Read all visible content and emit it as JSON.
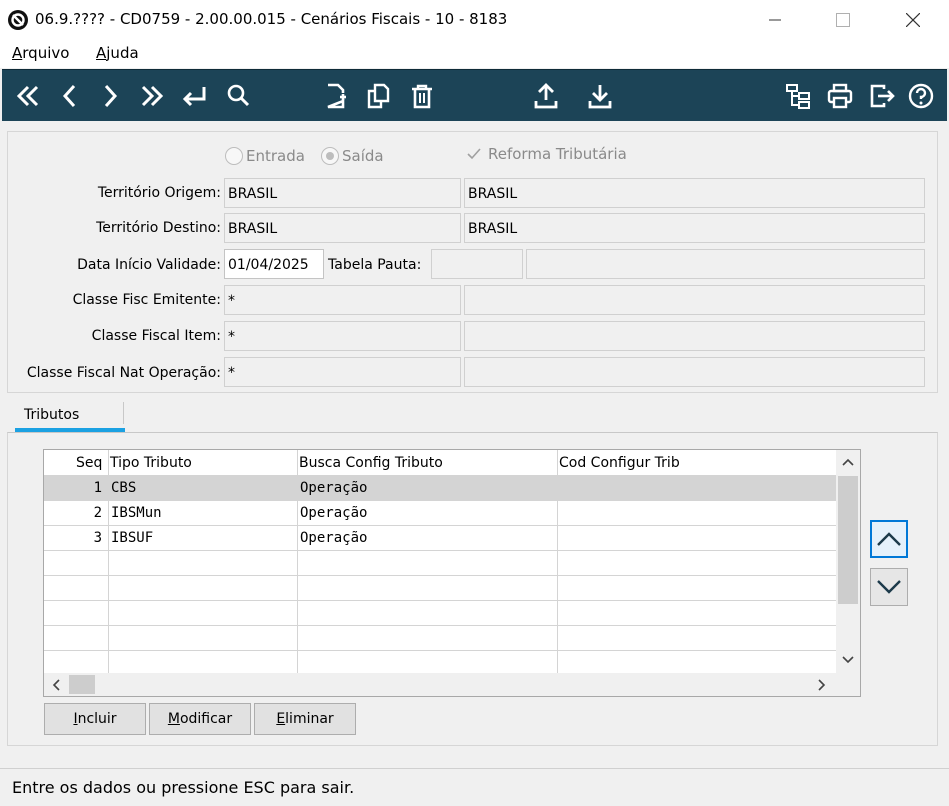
{
  "window": {
    "title": "06.9.???? - CD0759 - 2.00.00.015 - Cenários Fiscais - 10 - 8183",
    "minimize_glyph": "—",
    "maximize_glyph": "☐",
    "close_glyph": "✕"
  },
  "menu": {
    "arquivo": {
      "first": "A",
      "rest": "rquivo"
    },
    "ajuda": {
      "first": "A",
      "rest": "juda"
    }
  },
  "toolbar": {
    "icons": [
      "first-record-icon",
      "previous-record-icon",
      "next-record-icon",
      "last-record-icon",
      "go-to-icon",
      "search-icon",
      "new-document-icon",
      "copy-icon",
      "delete-icon",
      "export-icon",
      "import-icon",
      "structure-icon",
      "print-icon",
      "exit-icon",
      "help-icon"
    ],
    "background": "#1c4457"
  },
  "form": {
    "radio_entrada": "Entrada",
    "radio_saida": "Saída",
    "reforma_label": "Reforma Tributária",
    "territorio_origem_label": "Território Origem:",
    "territorio_origem_code": "BRASIL",
    "territorio_origem_desc": "BRASIL",
    "territorio_destino_label": "Território Destino:",
    "territorio_destino_code": "BRASIL",
    "territorio_destino_desc": "BRASIL",
    "data_inicio_label": "Data Início Validade:",
    "data_inicio_value": "01/04/2025",
    "tabela_pauta_label": "Tabela Pauta:",
    "tabela_pauta_code": "",
    "tabela_pauta_desc": "",
    "classe_emitente_label": "Classe Fisc Emitente:",
    "classe_emitente_value": "*",
    "classe_emitente_desc": "",
    "classe_item_label": "Classe Fiscal Item:",
    "classe_item_value": "*",
    "classe_item_desc": "",
    "classe_natop_label": "Classe Fiscal Nat Operação:",
    "classe_natop_value": "*",
    "classe_natop_desc": ""
  },
  "tabs": {
    "tributos": "Tributos"
  },
  "grid": {
    "columns": [
      "Seq",
      "Tipo Tributo",
      "Busca Config Tributo",
      "Cod Configur Trib"
    ],
    "rows": [
      {
        "seq": "1",
        "tipo": "CBS",
        "busca": "Operação",
        "cod": ""
      },
      {
        "seq": "2",
        "tipo": "IBSMun",
        "busca": "Operação",
        "cod": ""
      },
      {
        "seq": "3",
        "tipo": "IBSUF",
        "busca": "Operação",
        "cod": ""
      }
    ]
  },
  "buttons": {
    "incluir": {
      "first": "I",
      "rest": "ncluir"
    },
    "modificar": {
      "first": "M",
      "rest": "odificar"
    },
    "eliminar": {
      "first": "E",
      "rest": "liminar"
    }
  },
  "status": {
    "text": "Entre os dados ou pressione ESC para sair."
  }
}
